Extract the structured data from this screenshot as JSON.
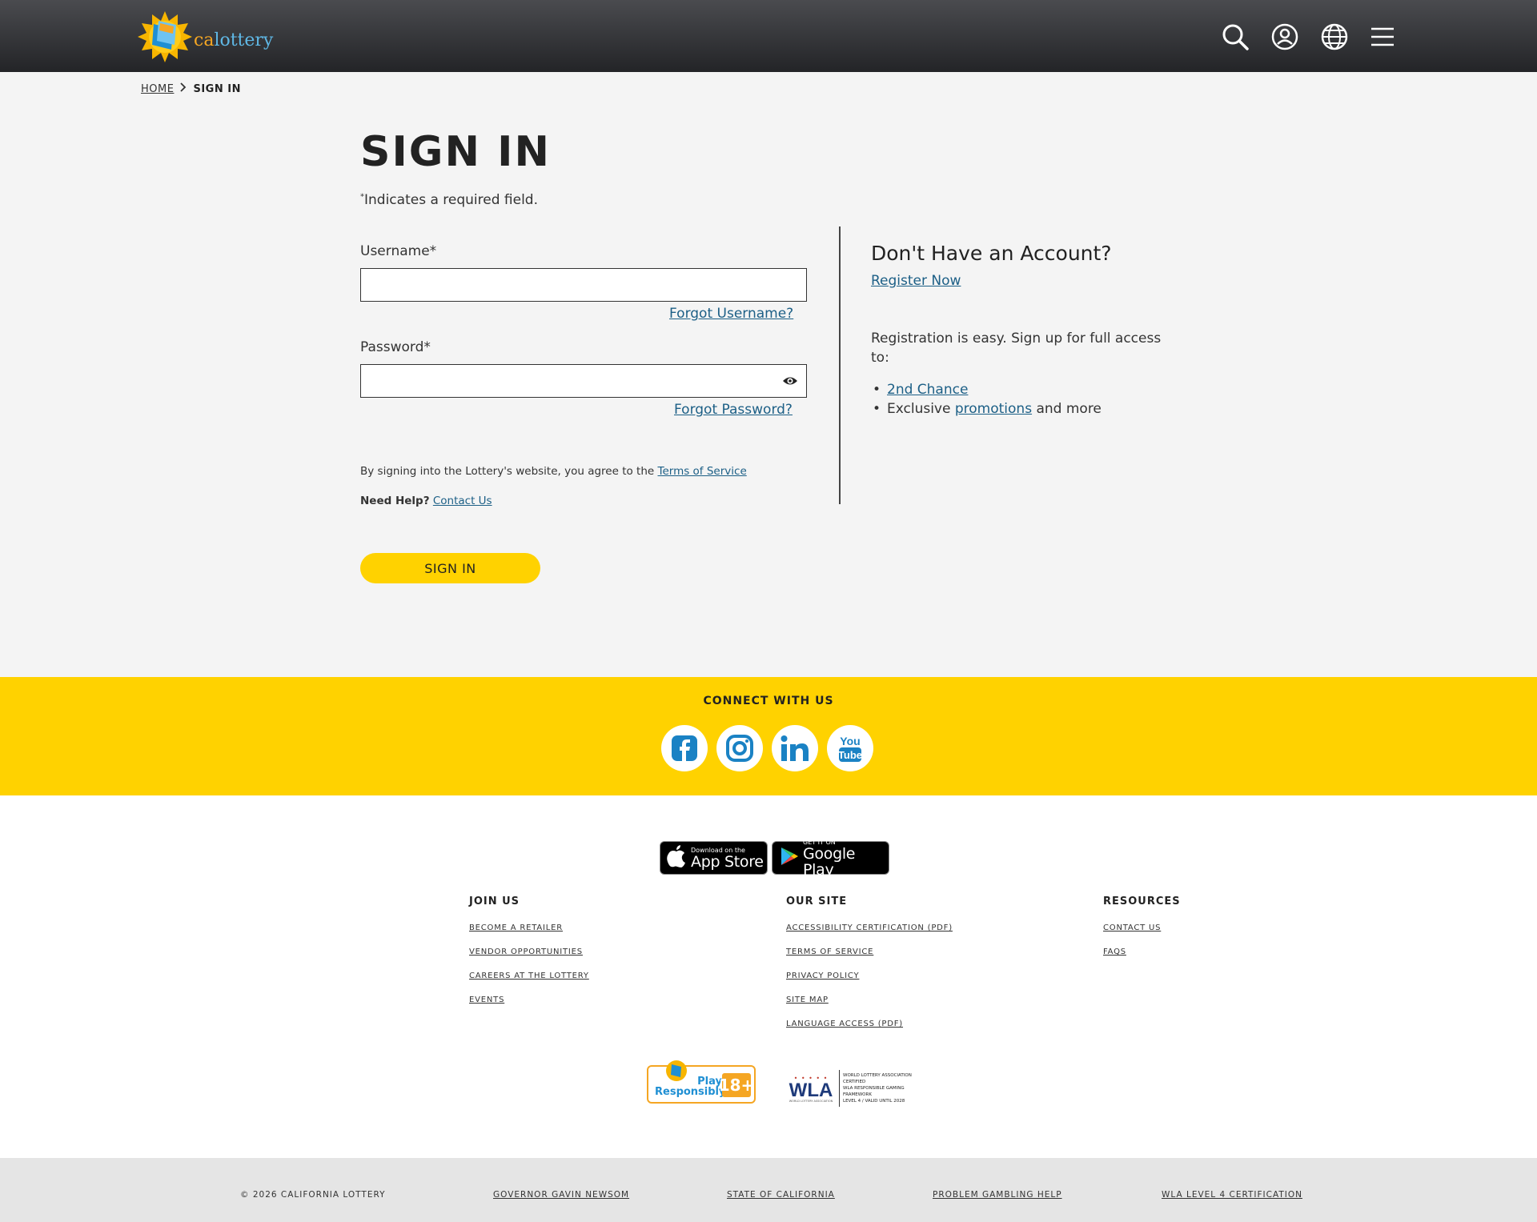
{
  "header": {
    "logo_ca": "ca",
    "logo_lottery": "lottery",
    "icons": [
      "search-icon",
      "account-icon",
      "globe-icon",
      "menu-icon"
    ]
  },
  "breadcrumb": {
    "home": "HOME",
    "current": "SIGN IN"
  },
  "signin": {
    "title": "SIGN IN",
    "required_mark": "*",
    "required_note": "Indicates a required field.",
    "username_label": "Username*",
    "username_value": "",
    "forgot_username": "Forgot Username?",
    "password_label": "Password*",
    "password_value": "",
    "forgot_password": "Forgot Password?",
    "legal_text": "By signing into the Lottery's website, you agree to the ",
    "terms_link": "Terms of Service",
    "help_label": "Need Help?",
    "contact_link": "Contact Us",
    "button": "SIGN IN"
  },
  "register": {
    "heading": "Don't Have an Account?",
    "link": "Register Now",
    "description": "Registration is easy. Sign up for full access to:",
    "benefit1_link": "2nd Chance",
    "benefit2_prefix": "Exclusive ",
    "benefit2_link": "promotions",
    "benefit2_suffix": " and more"
  },
  "connect": {
    "title": "CONNECT WITH US",
    "socials": [
      "facebook-icon",
      "instagram-icon",
      "linkedin-icon",
      "youtube-icon"
    ]
  },
  "stores": {
    "apple_small": "Download on the",
    "apple_big": "App Store",
    "google_small": "GET IT ON",
    "google_big": "Google Play"
  },
  "footer": {
    "join": {
      "heading": "JOIN US",
      "links": [
        "BECOME A RETAILER",
        "VENDOR OPPORTUNITIES",
        "CAREERS AT THE LOTTERY",
        "EVENTS"
      ]
    },
    "site": {
      "heading": "OUR SITE",
      "links": [
        "ACCESSIBILITY CERTIFICATION (PDF)",
        "TERMS OF SERVICE",
        "PRIVACY POLICY",
        "SITE MAP",
        "LANGUAGE ACCESS (PDF)"
      ]
    },
    "resources": {
      "heading": "RESOURCES",
      "links": [
        "CONTACT US",
        "FAQS"
      ]
    }
  },
  "badges": {
    "play_line1": "Play",
    "play_line2": "Responsibly",
    "play_age": "18+",
    "wla_logo": "WLA",
    "wla_sub": "WORLD LOTTERY ASSOCIATION",
    "wla_text": [
      "WORLD LOTTERY ASSOCIATION",
      "CERTIFIED",
      "WLA RESPONSIBLE GAMING",
      "FRAMEWORK",
      "LEVEL 4 / VALID UNTIL 2028"
    ]
  },
  "bottom": {
    "copyright": "© 2026 CALIFORNIA LOTTERY",
    "links": [
      "GOVERNOR GAVIN NEWSOM",
      "STATE OF CALIFORNIA",
      "PROBLEM GAMBLING HELP",
      "WLA LEVEL 4 CERTIFICATION"
    ]
  },
  "colors": {
    "brand_yellow": "#ffd200",
    "link_blue": "#1c5f86",
    "social_blue": "#1a82c4",
    "header_dark": "#2a2b2e"
  }
}
